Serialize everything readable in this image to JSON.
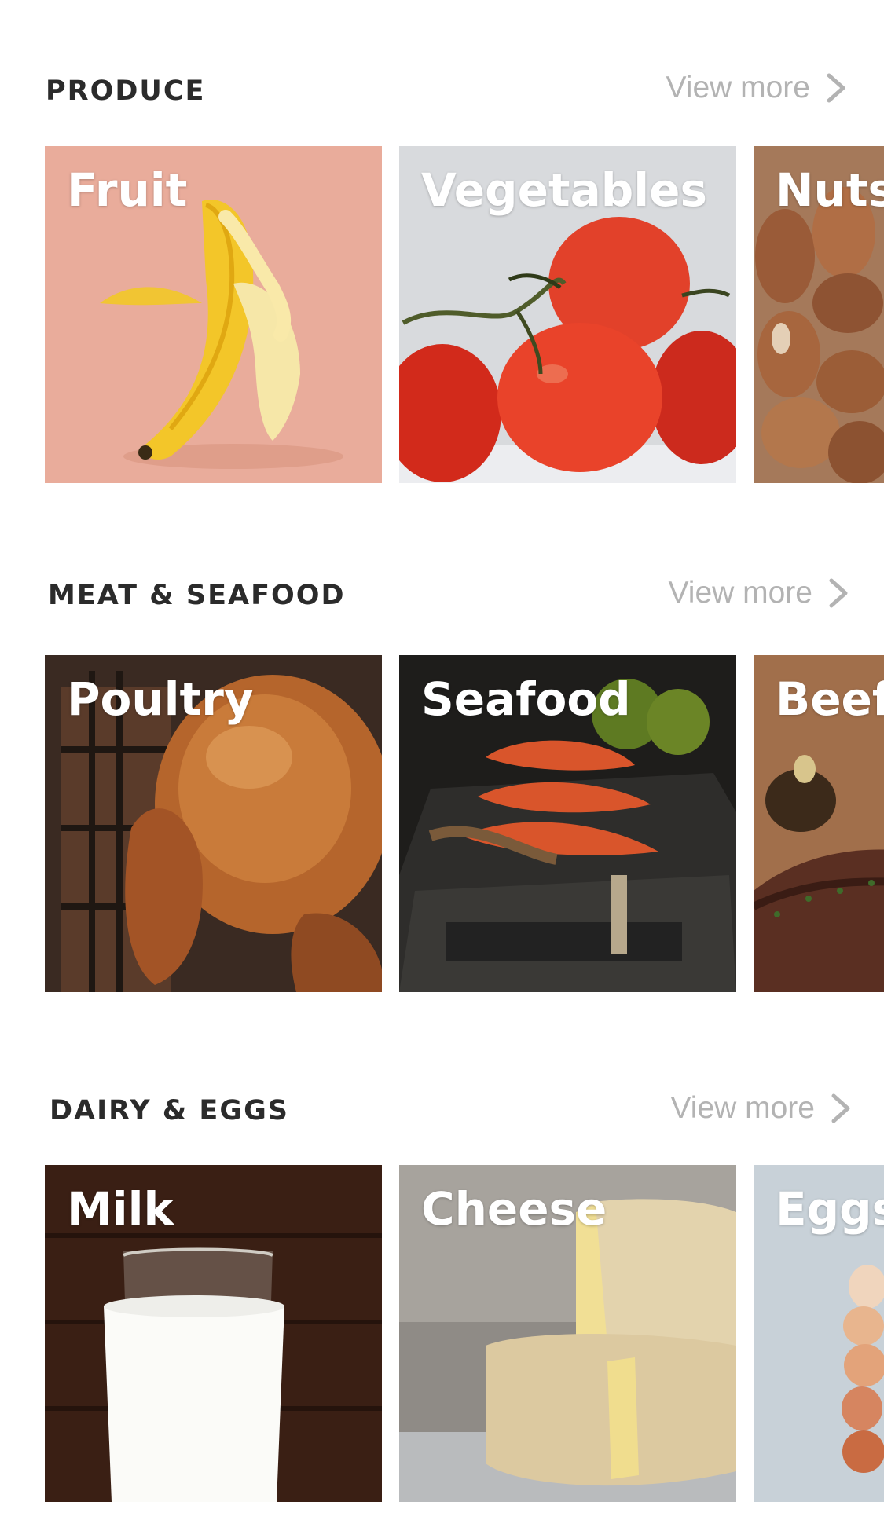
{
  "sections": [
    {
      "title": "PRODUCE",
      "view_more": "View more",
      "cards": [
        {
          "label": "Fruit"
        },
        {
          "label": "Vegetables"
        },
        {
          "label": "Nuts"
        }
      ]
    },
    {
      "title": "MEAT & SEAFOOD",
      "view_more": "View more",
      "cards": [
        {
          "label": "Poultry"
        },
        {
          "label": "Seafood"
        },
        {
          "label": "Beef"
        }
      ]
    },
    {
      "title": "DAIRY & EGGS",
      "view_more": "View more",
      "cards": [
        {
          "label": "Milk"
        },
        {
          "label": "Cheese"
        },
        {
          "label": "Eggs"
        }
      ]
    }
  ],
  "colors": {
    "title": "#2b2b2b",
    "view_more": "#b3b3b3",
    "card_label": "#ffffff"
  }
}
